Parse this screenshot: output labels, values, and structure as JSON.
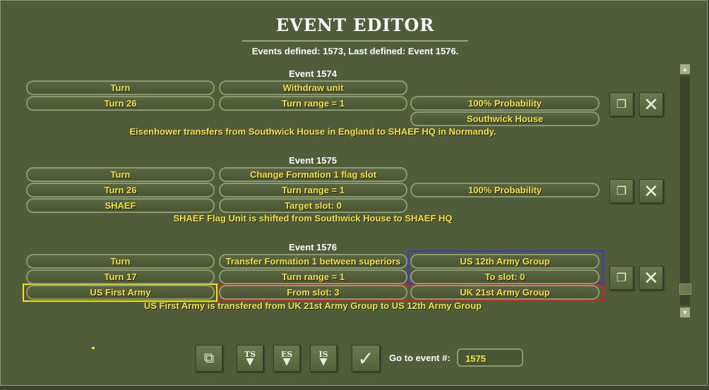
{
  "title": "EVENT EDITOR",
  "summary": "Events defined:  1573, Last defined: Event  1576.",
  "events": [
    {
      "header": "Event 1574",
      "cells": [
        "Turn",
        "Withdraw unit",
        "Turn 26",
        "Turn range = 1",
        "100% Probability",
        "Southwick House"
      ],
      "description": "Eisenhower transfers from Southwick House in England to SHAEF HQ in Normandy."
    },
    {
      "header": "Event 1575",
      "cells": [
        "Turn",
        "Change Formation 1 flag slot",
        "Turn 26",
        "Turn range = 1",
        "100% Probability",
        "SHAEF",
        "Target slot: 0"
      ],
      "description": "SHAEF Flag Unit is shifted from Southwick House to SHAEF HQ"
    },
    {
      "header": "Event 1576",
      "cells": [
        "Turn",
        "Transfer Formation 1 between superiors",
        "US 12th Army Group",
        "Turn 17",
        "Turn range = 1",
        "To slot: 0",
        "US First Army",
        "From slot: 3",
        "UK 21st Army Group"
      ],
      "description": "US First Army is transfered from UK 21st Army Group to US 12th Army Group"
    }
  ],
  "toolbar": {
    "ts": "TS",
    "es": "ES",
    "is": "IS",
    "goto_label": "Go to event #:",
    "goto_value": "1575"
  },
  "colors": {
    "text": "#f2e33a",
    "blue": "#3a3ac8",
    "red": "#d82020",
    "yellow": "#f5e800"
  }
}
